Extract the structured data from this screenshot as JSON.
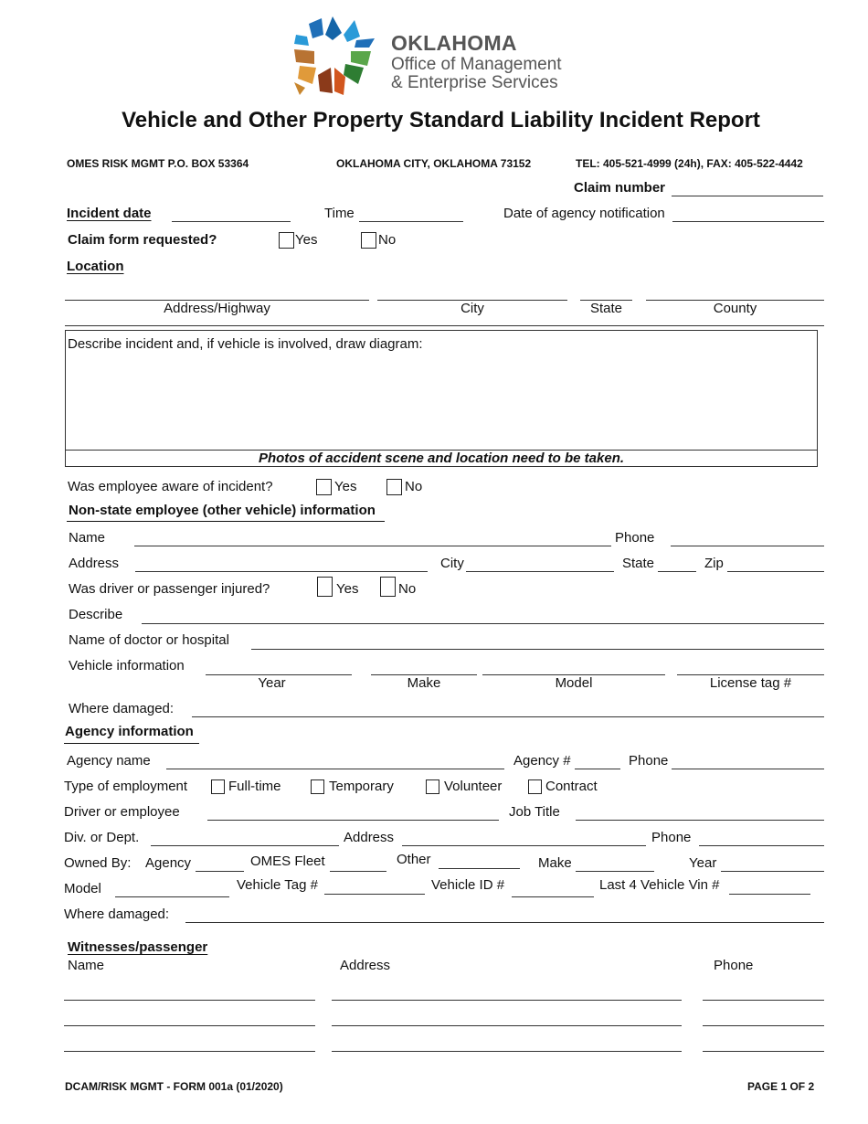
{
  "logo": {
    "icon": "oklahoma-star-logo-icon",
    "line1": "OKLAHOMA",
    "line2": "Office of Management",
    "line3": "& Enterprise Services",
    "colors": [
      "#1f6fb8",
      "#2a9ad8",
      "#5aa64a",
      "#2e7d32",
      "#d9822b",
      "#c8501e",
      "#8b4513"
    ]
  },
  "title": "Vehicle and Other Property Standard Liability Incident Report",
  "header": {
    "address": "OMES RISK MGMT  P.O. BOX 53364",
    "city": "OKLAHOMA CITY, OKLAHOMA  73152",
    "contact": "TEL: 405-521-4999 (24h),  FAX: 405-522-4442",
    "claim_number_label": "Claim number"
  },
  "incident": {
    "date_label": "Incident date",
    "time_label": "Time",
    "agency_notification_label": "Date of agency notification",
    "claim_form_label": "Claim form requested?",
    "yes": "Yes",
    "no": "No",
    "location_label": "Location",
    "location_captions": [
      "Address/Highway",
      "City",
      "State",
      "County"
    ]
  },
  "description": {
    "prompt": "Describe incident and, if vehicle is involved, draw diagram:",
    "photos_note": "Photos of accident scene and location need to be taken."
  },
  "employee_aware": {
    "label": "Was employee aware of incident?",
    "yes": "Yes",
    "no": "No"
  },
  "non_state": {
    "heading": "Non-state employee (other vehicle) information",
    "name_label": "Name",
    "phone_label": "Phone",
    "address_label": "Address",
    "city_label": "City",
    "state_label": "State",
    "zip_label": "Zip",
    "injured_label": "Was driver or passenger injured?",
    "yes": "Yes",
    "no": "No",
    "describe_label": "Describe",
    "doctor_label": "Name of doctor or hospital",
    "vehicle_label": "Vehicle information",
    "vehicle_captions": [
      "Year",
      "Make",
      "Model",
      "License tag #"
    ],
    "where_damaged_label": "Where damaged:"
  },
  "agency": {
    "heading": "Agency information",
    "agency_name_label": "Agency name",
    "agency_num_label": "Agency #",
    "phone_label": "Phone",
    "employment_label": "Type of employment",
    "employment_options": [
      "Full-time",
      "Temporary",
      "Volunteer",
      "Contract"
    ],
    "driver_label": "Driver or employee",
    "job_title_label": "Job Title",
    "div_label": "Div. or Dept.",
    "address_label": "Address",
    "phone2_label": "Phone",
    "owned_by_label": "Owned By:",
    "agency_label": "Agency",
    "omes_fleet_label": "OMES Fleet",
    "other_label": "Other",
    "make_label": "Make",
    "year_label": "Year",
    "model_label": "Model",
    "vehicle_tag_label": "Vehicle Tag #",
    "vehicle_id_label": "Vehicle ID #",
    "vin_label": "Last 4 Vehicle Vin #",
    "where_damaged_label": "Where damaged:"
  },
  "witnesses": {
    "heading": "Witnesses/passenger",
    "columns": [
      "Name",
      "Address",
      "Phone"
    ],
    "rows": 3
  },
  "footer": {
    "form_id": "DCAM/RISK MGMT - FORM 001a (01/2020)",
    "page": "PAGE 1 OF 2"
  }
}
